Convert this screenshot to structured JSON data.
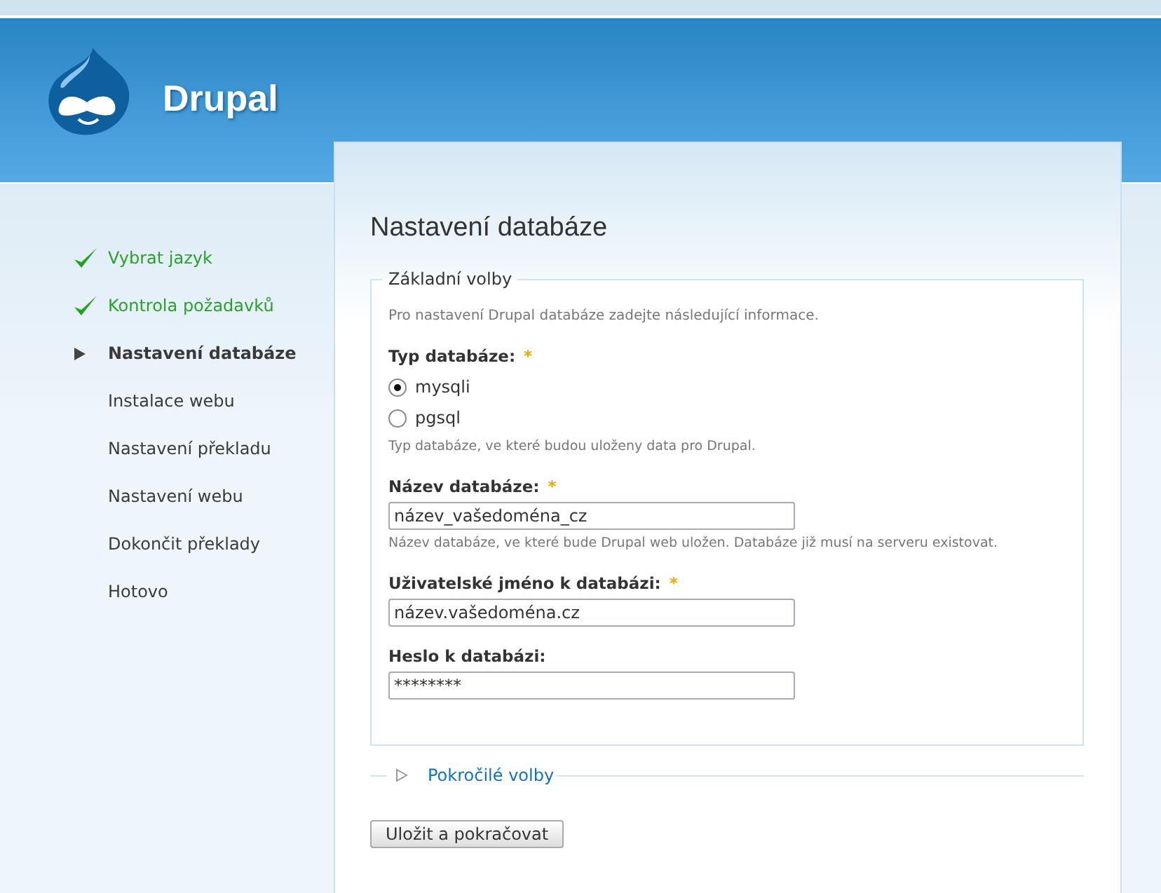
{
  "site": {
    "name": "Drupal"
  },
  "steps": [
    {
      "label": "Vybrat jazyk",
      "kind": "done"
    },
    {
      "label": "Kontrola požadavků",
      "kind": "done"
    },
    {
      "label": "Nastavení databáze",
      "kind": "active"
    },
    {
      "label": "Instalace webu",
      "kind": "pending"
    },
    {
      "label": "Nastavení překladu",
      "kind": "pending"
    },
    {
      "label": "Nastavení webu",
      "kind": "pending"
    },
    {
      "label": "Dokončit překlady",
      "kind": "pending"
    },
    {
      "label": "Hotovo",
      "kind": "pending"
    }
  ],
  "page_title": "Nastavení databáze",
  "fieldset": {
    "legend": "Základní volby",
    "intro": "Pro nastavení Drupal databáze zadejte následující informace.",
    "fields": [
      {
        "kind": "radios",
        "label": "Typ databáze:",
        "required": true,
        "options": [
          {
            "label": "mysqli",
            "selected": true
          },
          {
            "label": "pgsql",
            "selected": false
          }
        ],
        "description": "Typ databáze, ve které budou uloženy data pro Drupal."
      },
      {
        "kind": "text",
        "label": "Název databáze:",
        "required": true,
        "value": "název_vašedoména_cz",
        "description": "Název databáze, ve které bude Drupal web uložen. Databáze již musí na serveru existovat."
      },
      {
        "kind": "text",
        "label": "Uživatelské jméno k databázi:",
        "required": true,
        "value": "název.vašedoména.cz"
      },
      {
        "kind": "text",
        "label": "Heslo k databázi:",
        "required": false,
        "value": "********"
      }
    ]
  },
  "advanced": {
    "label": "Pokročilé volby",
    "expanded": false
  },
  "submit": "Uložit a pokračovat",
  "required_mark": "*"
}
